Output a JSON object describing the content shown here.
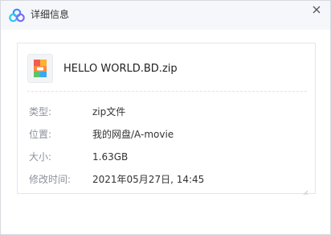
{
  "window": {
    "title": "详细信息",
    "app_icon": "cloud-logo-icon",
    "close_icon": "close-icon"
  },
  "file": {
    "name": "HELLO WORLD.BD.zip",
    "icon": "zip-archive-icon"
  },
  "details": [
    {
      "label": "类型:",
      "value": "zip文件"
    },
    {
      "label": "位置:",
      "value": "我的网盘/A-movie"
    },
    {
      "label": "大小:",
      "value": "1.63GB"
    },
    {
      "label": "修改时间:",
      "value": "2021年05月27日, 14:45"
    }
  ],
  "colors": {
    "title_bar_bg": "#f5f7fa",
    "label_text": "#8c929c",
    "value_text": "#333333",
    "logo_blue": "#3b8cff",
    "logo_purple": "#7c6cf0"
  }
}
